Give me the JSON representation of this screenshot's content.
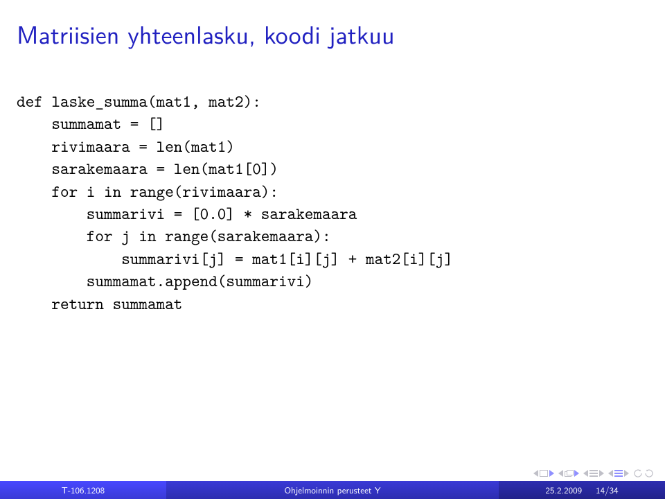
{
  "title": "Matriisien yhteenlasku, koodi jatkuu",
  "code": {
    "l1": "def laske_summa(mat1, mat2):",
    "l2": "    summamat = []",
    "l3": "    rivimaara = len(mat1)",
    "l4": "    sarakemaara = len(mat1[0])",
    "l5": "    for i in range(rivimaara):",
    "l6": "        summarivi = [0.0] * sarakemaara",
    "l7": "        for j in range(sarakemaara):",
    "l8": "            summarivi[j] = mat1[i][j] + mat2[i][j]",
    "l9": "        summamat.append(summarivi)",
    "l10": "    return summamat"
  },
  "footer": {
    "left": "T-106.1208",
    "mid": "Ohjelmoinnin perusteet Y",
    "date": "25.2.2009",
    "page_current": "14",
    "page_sep": " / ",
    "page_total": "34"
  }
}
